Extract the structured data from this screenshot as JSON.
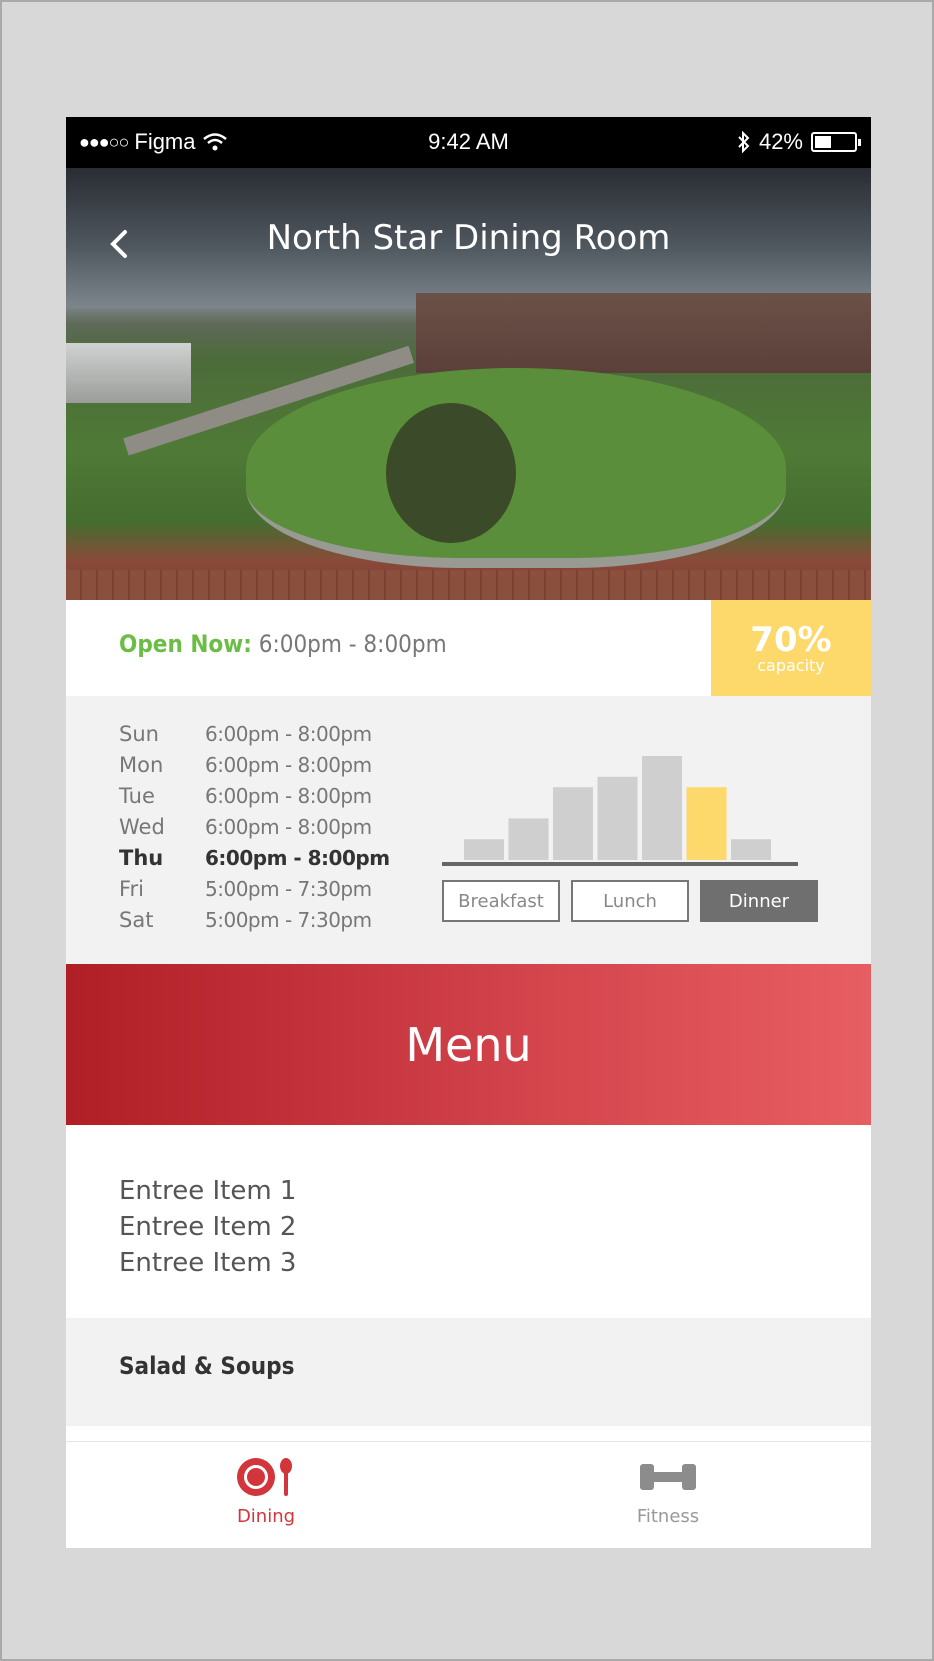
{
  "status_bar": {
    "carrier": "Figma",
    "signal_dots": "●●●○○",
    "time": "9:42 AM",
    "battery": "42%",
    "battery_level": 0.42
  },
  "header": {
    "title": "North Star Dining Room",
    "back_icon": "chevron-left-icon"
  },
  "open_status": {
    "label": "Open Now:",
    "hours": "6:00pm - 8:00pm"
  },
  "capacity": {
    "value": "70%",
    "label": "capacity",
    "color": "#fdd86a"
  },
  "hours": [
    {
      "day": "Sun",
      "time": "6:00pm - 8:00pm",
      "today": false
    },
    {
      "day": "Mon",
      "time": "6:00pm - 8:00pm",
      "today": false
    },
    {
      "day": "Tue",
      "time": "6:00pm - 8:00pm",
      "today": false
    },
    {
      "day": "Wed",
      "time": "6:00pm - 8:00pm",
      "today": false
    },
    {
      "day": "Thu",
      "time": "6:00pm - 8:00pm",
      "today": true
    },
    {
      "day": "Fri",
      "time": "5:00pm - 7:30pm",
      "today": false
    },
    {
      "day": "Sat",
      "time": "5:00pm - 7:30pm",
      "today": false
    }
  ],
  "busyness_chart": {
    "values": [
      2,
      4,
      7,
      8,
      10,
      7,
      2
    ],
    "highlight_index": 5,
    "bar_color": "#cfcfcf",
    "highlight_color": "#fdd86a"
  },
  "meal_tabs": [
    {
      "label": "Breakfast",
      "active": false
    },
    {
      "label": "Lunch",
      "active": false
    },
    {
      "label": "Dinner",
      "active": true
    }
  ],
  "menu": {
    "title": "Menu",
    "entrees": [
      "Entree Item 1",
      "Entree Item 2",
      "Entree Item 3"
    ],
    "next_section": "Salad & Soups"
  },
  "tab_bar": {
    "dining": {
      "label": "Dining",
      "icon": "plate-utensil-icon",
      "color": "#d2353b"
    },
    "fitness": {
      "label": "Fitness",
      "icon": "dumbbell-icon",
      "color": "#999999"
    }
  }
}
